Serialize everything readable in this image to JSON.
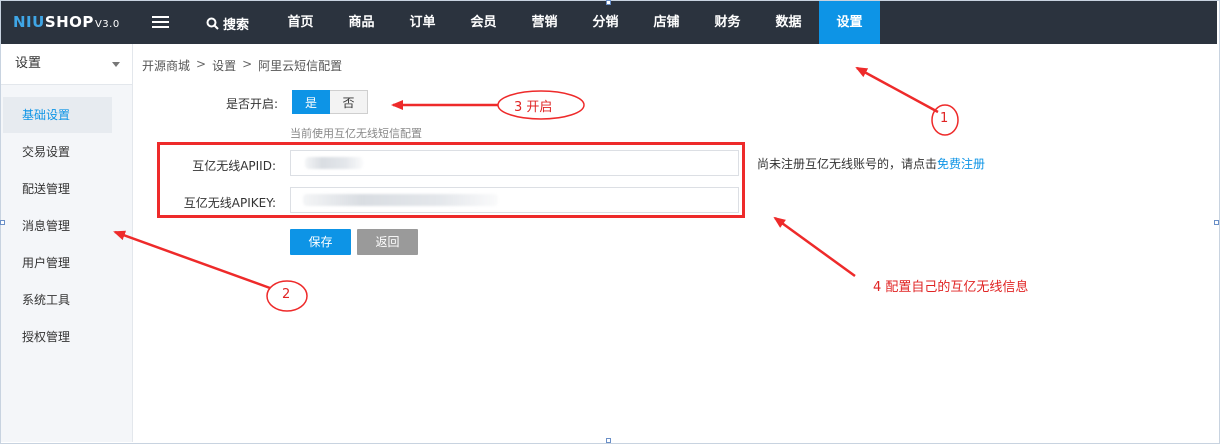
{
  "logo": {
    "brand_a": "NIU",
    "brand_b": "SHOP",
    "version": "V3.0"
  },
  "topbar": {
    "search_label": "搜索",
    "nav": [
      "首页",
      "商品",
      "订单",
      "会员",
      "营销",
      "分销",
      "店铺",
      "财务",
      "数据",
      "设置"
    ],
    "active_index": 9
  },
  "sidebar": {
    "header": "设置",
    "items": [
      "基础设置",
      "交易设置",
      "配送管理",
      "消息管理",
      "用户管理",
      "系统工具",
      "授权管理"
    ],
    "active_index": 0
  },
  "breadcrumb": {
    "home": "开源商城",
    "level1": "设置",
    "level2": "阿里云短信配置",
    "separator": ">"
  },
  "form": {
    "enable_label": "是否开启:",
    "enable_yes": "是",
    "enable_no": "否",
    "enabled": true,
    "hint": "当前使用互亿无线短信配置",
    "apiid_label": "互亿无线APIID:",
    "apikey_label": "互亿无线APIKEY:",
    "apiid_value": "",
    "apikey_value": "",
    "register_note": "尚未注册互亿无线账号的，请点击",
    "register_link": "免费注册",
    "save_button": "保存",
    "back_button": "返回"
  },
  "annotations": {
    "n1": "1",
    "n2": "2",
    "n3": "3 开启",
    "n4": "4 配置自己的互亿无线信息",
    "color": "#e02424"
  },
  "colors": {
    "accent": "#0d94e6",
    "topbar": "#2b333e",
    "annotation": "#ee2a2a"
  }
}
